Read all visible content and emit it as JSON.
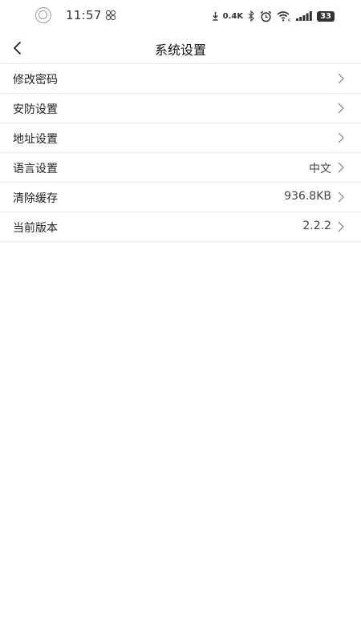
{
  "status_bar": {
    "time": "11:57",
    "net_speed": "0.4K",
    "battery": "33",
    "icons": [
      "notification-ring-icon",
      "wechat-knot-icon",
      "download-arrow-icon",
      "bluetooth-icon",
      "alarm-icon",
      "wifi-icon",
      "signal-icon",
      "battery-icon"
    ]
  },
  "header": {
    "title": "系统设置",
    "back_icon": "chevron-left-icon"
  },
  "settings": [
    {
      "label": "修改密码",
      "value": ""
    },
    {
      "label": "安防设置",
      "value": ""
    },
    {
      "label": "地址设置",
      "value": ""
    },
    {
      "label": "语言设置",
      "value": "中文"
    },
    {
      "label": "清除缓存",
      "value": "936.8KB"
    },
    {
      "label": "当前版本",
      "value": "2.2.2"
    }
  ],
  "colors": {
    "background": "#ffffff",
    "divider": "#ececec",
    "chevron": "#8c8c8c"
  }
}
